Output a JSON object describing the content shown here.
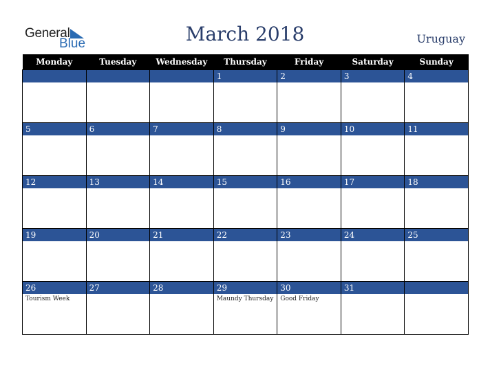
{
  "logo": {
    "general": "General",
    "blue": "Blue"
  },
  "title": "March 2018",
  "country": "Uruguay",
  "weekdays": [
    "Monday",
    "Tuesday",
    "Wednesday",
    "Thursday",
    "Friday",
    "Saturday",
    "Sunday"
  ],
  "weeks": [
    [
      {
        "d": ""
      },
      {
        "d": ""
      },
      {
        "d": ""
      },
      {
        "d": "1"
      },
      {
        "d": "2"
      },
      {
        "d": "3"
      },
      {
        "d": "4"
      }
    ],
    [
      {
        "d": "5"
      },
      {
        "d": "6"
      },
      {
        "d": "7"
      },
      {
        "d": "8"
      },
      {
        "d": "9"
      },
      {
        "d": "10"
      },
      {
        "d": "11"
      }
    ],
    [
      {
        "d": "12"
      },
      {
        "d": "13"
      },
      {
        "d": "14"
      },
      {
        "d": "15"
      },
      {
        "d": "16"
      },
      {
        "d": "17"
      },
      {
        "d": "18"
      }
    ],
    [
      {
        "d": "19"
      },
      {
        "d": "20"
      },
      {
        "d": "21"
      },
      {
        "d": "22"
      },
      {
        "d": "23"
      },
      {
        "d": "24"
      },
      {
        "d": "25"
      }
    ],
    [
      {
        "d": "26",
        "e": "Tourism Week"
      },
      {
        "d": "27"
      },
      {
        "d": "28"
      },
      {
        "d": "29",
        "e": "Maundy Thursday"
      },
      {
        "d": "30",
        "e": "Good Friday"
      },
      {
        "d": "31"
      },
      {
        "d": ""
      }
    ]
  ]
}
